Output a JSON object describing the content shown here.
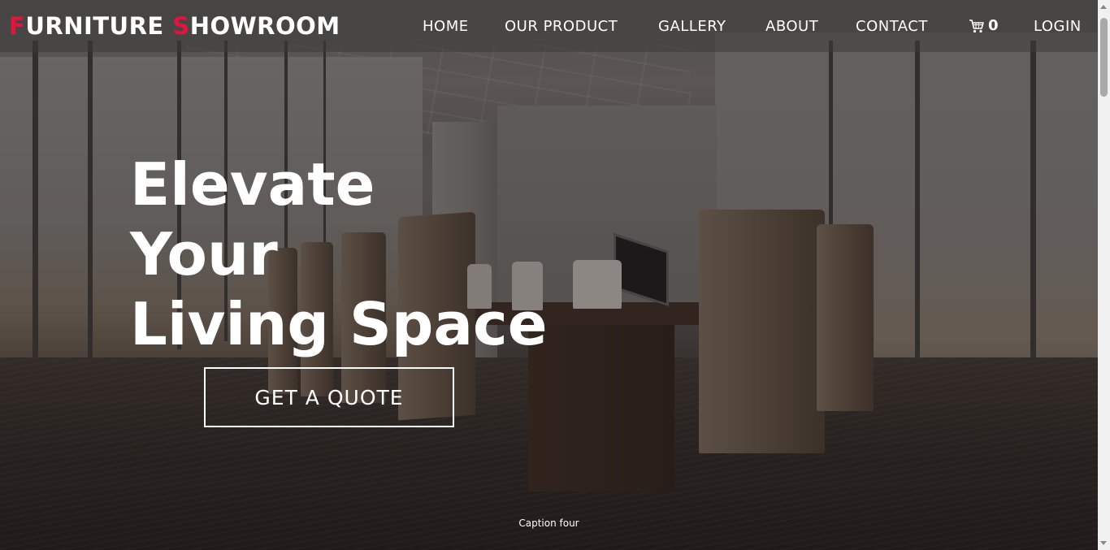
{
  "brand": {
    "first_initial": "F",
    "first_rest": "URNITURE ",
    "second_initial": "S",
    "second_rest": "HOWROOM",
    "accent_color": "#e1153b"
  },
  "nav": {
    "items": [
      {
        "label": "HOME"
      },
      {
        "label": "OUR PRODUCT"
      },
      {
        "label": "GALLERY"
      },
      {
        "label": "ABOUT"
      },
      {
        "label": "CONTACT"
      }
    ],
    "cart_icon": "shopping-cart-icon",
    "cart_count": "0",
    "login_label": "LOGIN"
  },
  "hero": {
    "headline_lines": [
      "Elevate",
      "Your",
      "Living Space"
    ],
    "cta_label": "GET A QUOTE",
    "caption": "Caption four"
  }
}
